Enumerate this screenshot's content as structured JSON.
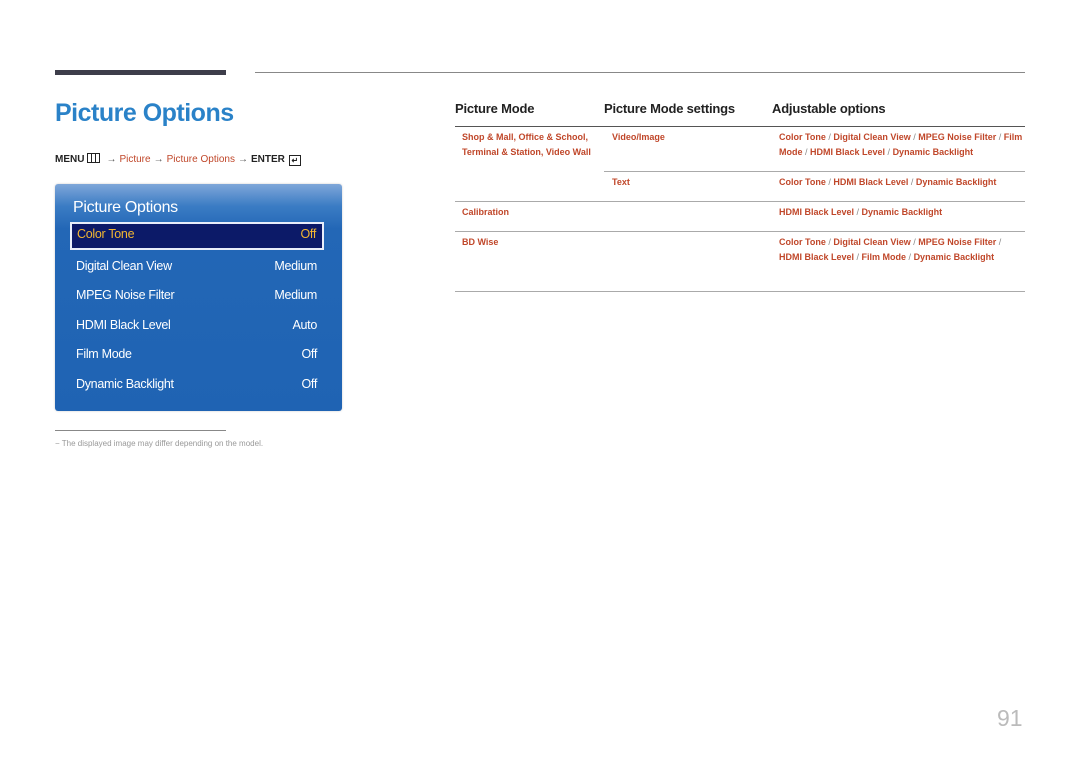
{
  "page": {
    "title": "Picture Options",
    "page_number": "91"
  },
  "path": {
    "menu": "MENU",
    "menu_icon": "menu-icon",
    "arrow": "→",
    "step1": "Picture",
    "step2": "Picture Options",
    "enter": "ENTER",
    "enter_icon": "enter-icon"
  },
  "osd": {
    "title": "Picture Options",
    "items": [
      {
        "label": "Color Tone",
        "value": "Off",
        "selected": true
      },
      {
        "label": "Digital Clean View",
        "value": "Medium"
      },
      {
        "label": "MPEG Noise Filter",
        "value": "Medium"
      },
      {
        "label": "HDMI Black Level",
        "value": "Auto"
      },
      {
        "label": "Film Mode",
        "value": "Off"
      },
      {
        "label": "Dynamic Backlight",
        "value": "Off"
      }
    ],
    "colors": {
      "selected_text": "#f2b632",
      "panel": "#1f63b3",
      "selected_bg": "#0c1a68"
    }
  },
  "footnote": "−  The displayed image may differ depending on the model.",
  "table": {
    "headers": [
      "Picture Mode",
      "Picture Mode settings",
      "Adjustable options"
    ],
    "rows": [
      {
        "mode": "Shop & Mall, Office & School, Terminal & Station, Video Wall",
        "setting": "Video/Image",
        "options": [
          "Color Tone",
          "Digital Clean View",
          "MPEG Noise Filter",
          "Film Mode",
          "HDMI Black Level",
          "Dynamic Backlight"
        ]
      },
      {
        "mode": "",
        "setting": "Text",
        "options": [
          "Color Tone",
          "HDMI Black Level",
          "Dynamic Backlight"
        ]
      },
      {
        "mode": "Calibration",
        "setting": "",
        "options": [
          "HDMI Black Level",
          "Dynamic Backlight"
        ]
      },
      {
        "mode": "BD Wise",
        "setting": "",
        "options": [
          "Color Tone",
          "Digital Clean View",
          "MPEG Noise Filter",
          "HDMI Black Level",
          "Film Mode",
          "Dynamic Backlight"
        ]
      }
    ],
    "link_color": "#c0472a"
  }
}
